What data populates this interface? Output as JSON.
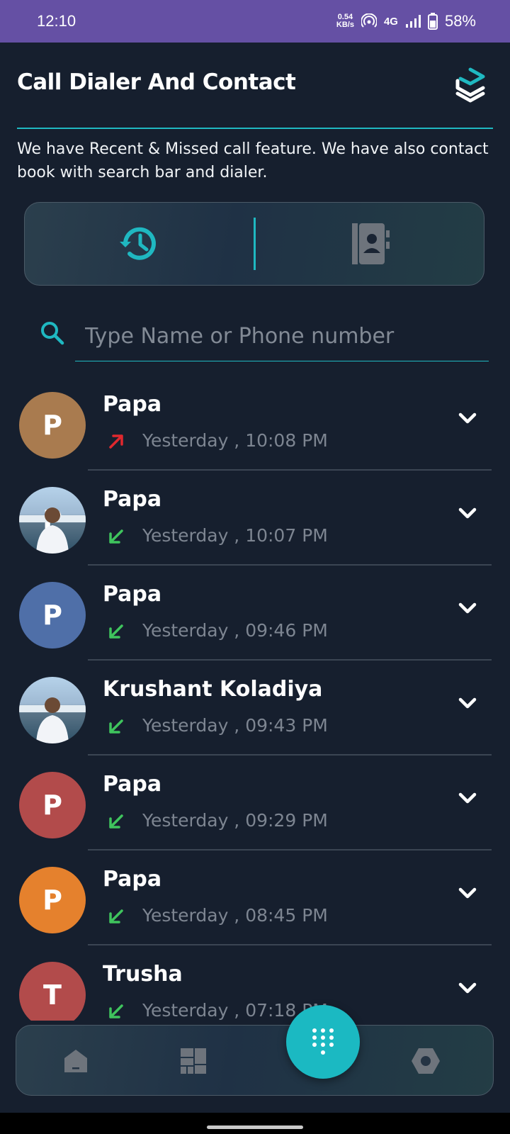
{
  "status_bar": {
    "time": "12:10",
    "speed_value": "0.54",
    "speed_unit": "KB/s",
    "network": "4G",
    "battery": "58%"
  },
  "header": {
    "title": "Call Dialer And Contact",
    "subtitle": "We have Recent & Missed call feature. We have also contact book with search bar and dialer."
  },
  "segment": {
    "recent_icon": "history-icon",
    "contacts_icon": "contact-book-icon"
  },
  "search": {
    "placeholder": "Type Name or Phone number"
  },
  "calls": [
    {
      "initial": "P",
      "name": "Papa",
      "time": "Yesterday , 10:08 PM",
      "direction": "outgoing",
      "avatar_color": "#a97b4f",
      "photo": false
    },
    {
      "initial": "P",
      "name": "Papa",
      "time": "Yesterday , 10:07 PM",
      "direction": "incoming",
      "avatar_color": "#9fbad3",
      "photo": true
    },
    {
      "initial": "P",
      "name": "Papa",
      "time": "Yesterday , 09:46 PM",
      "direction": "incoming",
      "avatar_color": "#4f6fa8",
      "photo": false
    },
    {
      "initial": "",
      "name": "Krushant Koladiya",
      "time": "Yesterday , 09:43 PM",
      "direction": "incoming",
      "avatar_color": "#9fbad3",
      "photo": true
    },
    {
      "initial": "P",
      "name": "Papa",
      "time": "Yesterday , 09:29 PM",
      "direction": "incoming",
      "avatar_color": "#b24b4b",
      "photo": false
    },
    {
      "initial": "P",
      "name": "Papa",
      "time": "Yesterday , 08:45 PM",
      "direction": "incoming",
      "avatar_color": "#e5812d",
      "photo": false
    },
    {
      "initial": "T",
      "name": "Trusha",
      "time": "Yesterday , 07:18 PM",
      "direction": "incoming",
      "avatar_color": "#b24b4b",
      "photo": false
    }
  ],
  "colors": {
    "accent": "#1fb8c1",
    "outgoing": "#e0282e",
    "incoming": "#3fc45d",
    "background": "#161f2e",
    "status_bar": "#6550a4"
  },
  "bottom_nav": {
    "items": [
      "home-icon",
      "dashboard-icon",
      "dialpad-icon",
      "settings-icon"
    ]
  }
}
